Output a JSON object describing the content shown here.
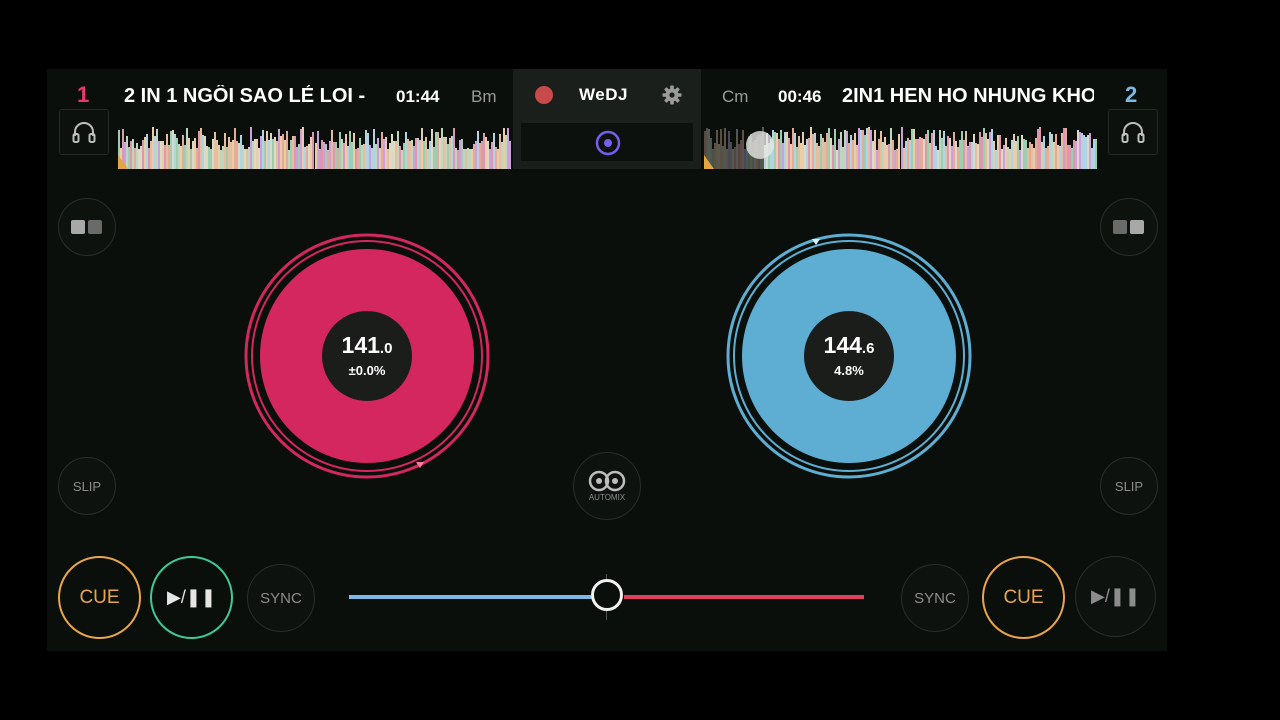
{
  "deck_left": {
    "number": "1",
    "title": "2 IN 1 NGÔI SAO LẺ LOI -",
    "time": "01:44",
    "key": "Bm",
    "bpm_main": "141",
    "bpm_dec": ".0",
    "pitch": "±0.0%",
    "color": "#d4275f",
    "slip_label": "SLIP",
    "cue_label": "CUE",
    "sync_label": "SYNC",
    "play_label": "▶/❚❚"
  },
  "deck_right": {
    "number": "2",
    "title": "2IN1 HEN HO NHUNG KHO",
    "time": "00:46",
    "key": "Cm",
    "bpm_main": "144",
    "bpm_dec": ".6",
    "pitch": "4.8%",
    "color": "#5eaed3",
    "slip_label": "SLIP",
    "cue_label": "CUE",
    "sync_label": "SYNC",
    "play_label": "▶/❚❚"
  },
  "header": {
    "logo": "WeDJ",
    "record_color": "#c84a4a"
  },
  "automix_label": "AUTOMIX",
  "crossfader": {
    "position": 0.5,
    "left_color": "#7fb8e6",
    "right_color": "#e0405e"
  },
  "icons": [
    "headphones-icon",
    "record-icon",
    "gear-icon",
    "view-toggle-icon",
    "automix-icon",
    "cue-indicator-icon"
  ]
}
